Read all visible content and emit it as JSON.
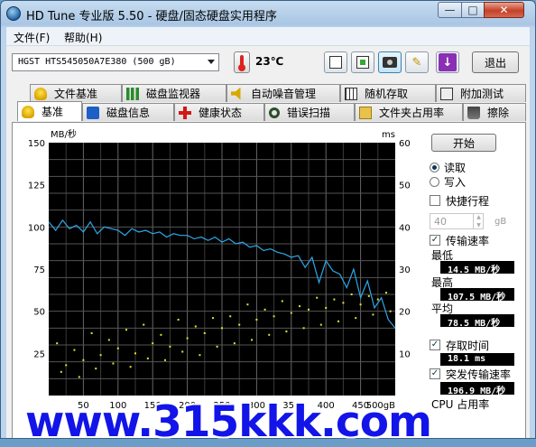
{
  "window": {
    "title": "HD Tune 专业版 5.50 - 硬盘/固态硬盘实用程序"
  },
  "captions": {
    "minimize": "—",
    "maximize": "□",
    "close": "✕"
  },
  "menu": {
    "file": "文件(F)",
    "help": "帮助(H)"
  },
  "toolbar": {
    "drive": "HGST HTS545050A7E380 (500 gB)",
    "temperature": "23℃",
    "exit_label": "退出",
    "icons": [
      "copy-icon",
      "copy-all-icon",
      "camera-icon",
      "options-icon",
      "save-icon"
    ]
  },
  "tabs_row1": [
    "文件基准",
    "磁盘监视器",
    "自动噪音管理",
    "随机存取",
    "附加测试"
  ],
  "tabs_row2": [
    "基准",
    "磁盘信息",
    "健康状态",
    "错误扫描",
    "文件夹占用率",
    "擦除"
  ],
  "active_tab": "基准",
  "controls": {
    "start_label": "开始",
    "read_label": "读取",
    "write_label": "写入",
    "mode": "read",
    "short_stroke_label": "快捷行程",
    "short_stroke_checked": false,
    "short_stroke_value": "40",
    "short_stroke_unit": "gB",
    "transfer_rate_label": "传输速率",
    "transfer_rate_checked": true,
    "min_label": "最低",
    "min_value": "14.5 MB/秒",
    "max_label": "最高",
    "max_value": "107.5 MB/秒",
    "avg_label": "平均",
    "avg_value": "78.5 MB/秒",
    "access_time_label": "存取时间",
    "access_time_checked": true,
    "access_time_value": "18.1 ms",
    "burst_label": "突发传输速率",
    "burst_checked": true,
    "burst_value": "196.9 MB/秒",
    "cpu_label": "CPU 占用率"
  },
  "chart_data": {
    "type": "line",
    "ylabel_left": "MB/秒",
    "ylabel_right": "ms",
    "y_left_ticks": [
      150,
      125,
      100,
      75,
      50,
      25
    ],
    "y_right_ticks": [
      60,
      50,
      40,
      30,
      20,
      10
    ],
    "ylim_left": [
      0,
      150
    ],
    "ylim_right": [
      0,
      60
    ],
    "x_tick_labels": [
      "50",
      "100",
      "150",
      "200",
      "250",
      "300",
      "350",
      "400",
      "450",
      "500gB"
    ],
    "xlim": [
      0,
      500
    ],
    "grid": true,
    "series": [
      {
        "color": "#2ea8e8",
        "x": [
          0,
          10,
          20,
          30,
          40,
          50,
          60,
          70,
          80,
          90,
          100,
          110,
          120,
          130,
          140,
          150,
          160,
          170,
          180,
          190,
          200,
          210,
          220,
          230,
          240,
          250,
          260,
          270,
          280,
          290,
          300,
          310,
          320,
          330,
          340,
          350,
          360,
          370,
          380,
          390,
          400,
          410,
          420,
          430,
          440,
          450,
          460,
          470,
          480,
          490,
          500
        ],
        "values": [
          103,
          98,
          104,
          99,
          101,
          97,
          103,
          96,
          100,
          99,
          98,
          95,
          99,
          97,
          98,
          96,
          97,
          94,
          96,
          95,
          95,
          93,
          94,
          92,
          94,
          91,
          93,
          90,
          91,
          88,
          89,
          86,
          87,
          85,
          84,
          82,
          83,
          76,
          82,
          67,
          80,
          74,
          72,
          64,
          75,
          58,
          68,
          52,
          58,
          45,
          40
        ]
      },
      {
        "color": "#e6e034",
        "points": [
          [
            12,
            31
          ],
          [
            25,
            18
          ],
          [
            37,
            27
          ],
          [
            50,
            21
          ],
          [
            62,
            37
          ],
          [
            75,
            24
          ],
          [
            87,
            33
          ],
          [
            100,
            28
          ],
          [
            112,
            39
          ],
          [
            125,
            25
          ],
          [
            137,
            42
          ],
          [
            150,
            31
          ],
          [
            162,
            36
          ],
          [
            175,
            29
          ],
          [
            187,
            45
          ],
          [
            200,
            34
          ],
          [
            212,
            41
          ],
          [
            225,
            37
          ],
          [
            237,
            46
          ],
          [
            250,
            40
          ],
          [
            262,
            47
          ],
          [
            275,
            42
          ],
          [
            287,
            54
          ],
          [
            300,
            45
          ],
          [
            312,
            51
          ],
          [
            325,
            47
          ],
          [
            337,
            56
          ],
          [
            350,
            49
          ],
          [
            362,
            53
          ],
          [
            375,
            51
          ],
          [
            387,
            58
          ],
          [
            400,
            52
          ],
          [
            412,
            57
          ],
          [
            425,
            55
          ],
          [
            437,
            60
          ],
          [
            450,
            54
          ],
          [
            462,
            59
          ],
          [
            475,
            57
          ],
          [
            487,
            61
          ],
          [
            18,
            14
          ],
          [
            44,
            11
          ],
          [
            68,
            16
          ],
          [
            93,
            19
          ],
          [
            118,
            17
          ],
          [
            143,
            22
          ],
          [
            168,
            21
          ],
          [
            193,
            26
          ],
          [
            218,
            24
          ],
          [
            243,
            29
          ],
          [
            268,
            31
          ],
          [
            293,
            33
          ],
          [
            318,
            36
          ],
          [
            343,
            38
          ],
          [
            368,
            40
          ],
          [
            393,
            42
          ],
          [
            418,
            44
          ],
          [
            443,
            46
          ],
          [
            468,
            48
          ],
          [
            493,
            50
          ]
        ]
      }
    ]
  },
  "watermark": "www.315kkk.com"
}
